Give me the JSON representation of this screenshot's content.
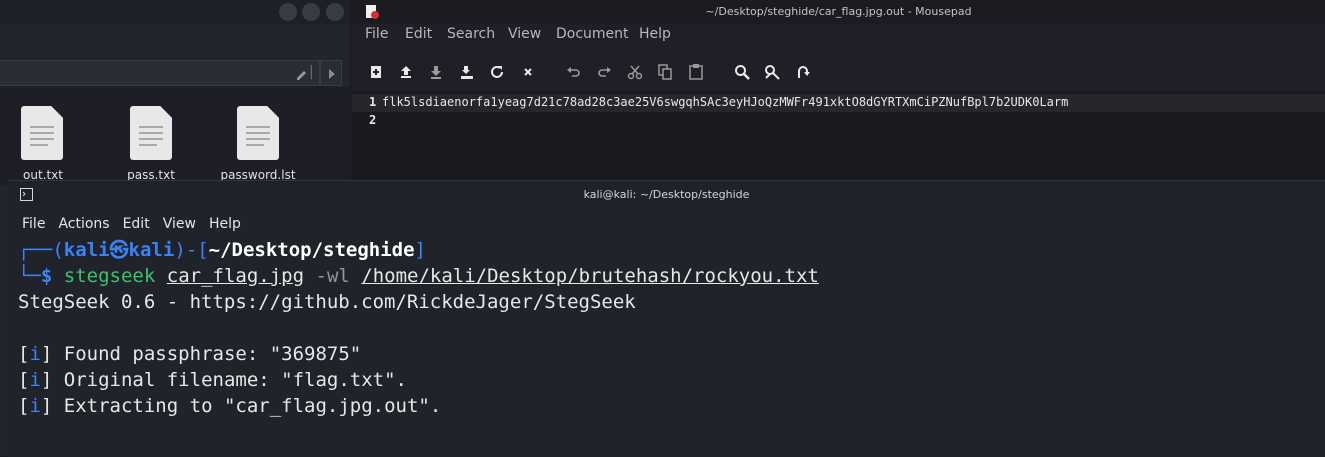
{
  "file_manager": {
    "files": [
      {
        "name": "out.txt"
      },
      {
        "name": "pass.txt"
      },
      {
        "name": "password.lst"
      }
    ]
  },
  "mousepad": {
    "title": "~/Desktop/steghide/car_flag.jpg.out - Mousepad",
    "menu": [
      "File",
      "Edit",
      "Search",
      "View",
      "Document",
      "Help"
    ],
    "toolbar_icons": [
      "new-document-icon",
      "open-icon",
      "save-icon",
      "save-as-icon",
      "reload-icon",
      "close-icon",
      "undo-icon",
      "redo-icon",
      "cut-icon",
      "copy-icon",
      "paste-icon",
      "find-icon",
      "find-replace-icon",
      "go-to-icon"
    ],
    "lines": [
      {
        "num": "1",
        "text": "flk5lsdiaenorfa1yeag7d21c78ad28c3ae25V6swgqhSAc3eyHJoQzMWFr491xktO8dGYRTXmCiPZNufBpl7b2UDK0Larm"
      },
      {
        "num": "2",
        "text": ""
      }
    ]
  },
  "terminal": {
    "title": "kali@kali: ~/Desktop/steghide",
    "menu": [
      "File",
      "Actions",
      "Edit",
      "View",
      "Help"
    ],
    "prompt": {
      "user": "kali",
      "host": "kali",
      "path": "~/Desktop/steghide"
    },
    "command": {
      "program": "stegseek",
      "arg1": "car_flag.jpg",
      "flag": "-wl",
      "arg2": "/home/kali/Desktop/brutehash/rockyou.txt"
    },
    "output": {
      "banner": "StegSeek 0.6 - https://github.com/RickdeJager/StegSeek",
      "info_tag": "i",
      "lines": [
        "Found passphrase: \"369875\"",
        "Original filename: \"flag.txt\".",
        "Extracting to \"car_flag.jpg.out\"."
      ]
    }
  },
  "colors": {
    "prompt_blue": "#3b82f6",
    "command_green": "#39c46c",
    "flag_gray": "#8e96a3"
  }
}
